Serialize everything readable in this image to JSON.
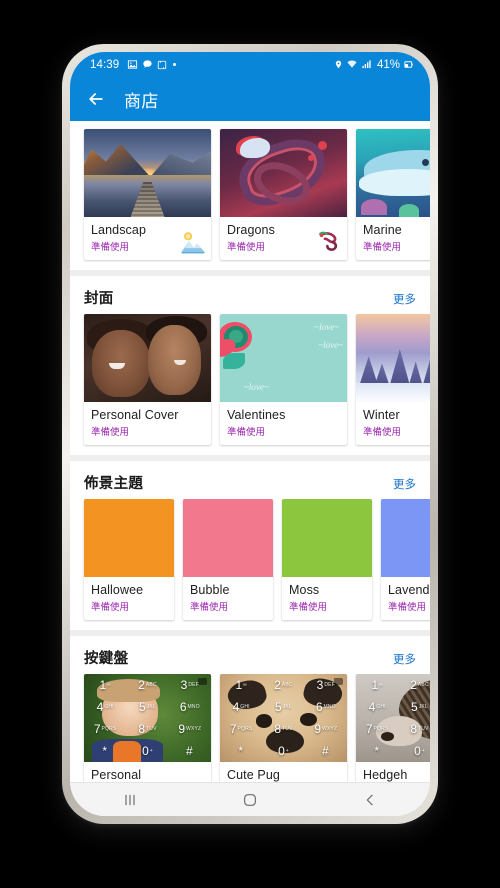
{
  "statusbar": {
    "time": "14:39",
    "battery_pct": "41%",
    "icons_left": [
      "image-icon",
      "chat-icon",
      "screenshot-icon",
      "dot-indicator"
    ],
    "icons_right": [
      "location-icon",
      "wifi-icon",
      "signal-icon",
      "battery-icon"
    ]
  },
  "appbar": {
    "back_icon": "back-arrow-icon",
    "title": "商店",
    "accent_color": "#0a86d8"
  },
  "labels": {
    "more": "更多",
    "ready_to_use": "準備使用"
  },
  "sections": [
    {
      "id": "featured",
      "title": "",
      "more": "",
      "items": [
        {
          "name": "Landscap",
          "status": "準備使用",
          "art": "landscape",
          "badge": "mountain-sun-icon"
        },
        {
          "name": "Dragons",
          "status": "準備使用",
          "art": "dragon",
          "badge": "dragon-icon"
        },
        {
          "name": "Marine",
          "status": "準備使用",
          "art": "marine",
          "badge": ""
        }
      ]
    },
    {
      "id": "covers",
      "title": "封面",
      "more": "更多",
      "items": [
        {
          "name": "Personal Cover",
          "status": "準備使用",
          "art": "personal-cover",
          "badge": ""
        },
        {
          "name": "Valentines",
          "status": "準備使用",
          "art": "valentines",
          "badge": ""
        },
        {
          "name": "Winter",
          "status": "準備使用",
          "art": "winter",
          "badge": ""
        }
      ]
    },
    {
      "id": "themes",
      "title": "佈景主題",
      "more": "更多",
      "items": [
        {
          "name": "Hallowee",
          "status": "準備使用",
          "art": "swatch",
          "color": "#f39422"
        },
        {
          "name": "Bubble",
          "status": "準備使用",
          "art": "swatch",
          "color": "#f2788d"
        },
        {
          "name": "Moss",
          "status": "準備使用",
          "art": "swatch",
          "color": "#8cc63e"
        },
        {
          "name": "Lavend",
          "status": "準備使用",
          "art": "swatch",
          "color": "#7b96f5"
        }
      ]
    },
    {
      "id": "keypad",
      "title": "按鍵盤",
      "more": "更多",
      "items": [
        {
          "name": "Personal",
          "status": "",
          "art": "keypad-baby"
        },
        {
          "name": "Cute Pug",
          "status": "",
          "art": "keypad-pug"
        },
        {
          "name": "Hedgeh",
          "status": "",
          "art": "keypad-hedgehog"
        }
      ]
    }
  ],
  "keypad_keys": [
    {
      "d": "1",
      "s": "∞"
    },
    {
      "d": "2",
      "s": "ABC"
    },
    {
      "d": "3",
      "s": "DEF"
    },
    {
      "d": "4",
      "s": "GHI"
    },
    {
      "d": "5",
      "s": "JKL"
    },
    {
      "d": "6",
      "s": "MNO"
    },
    {
      "d": "7",
      "s": "PQRS"
    },
    {
      "d": "8",
      "s": "TUV"
    },
    {
      "d": "9",
      "s": "WXYZ"
    },
    {
      "d": "*",
      "s": ""
    },
    {
      "d": "0",
      "s": "+"
    },
    {
      "d": "#",
      "s": ""
    }
  ],
  "navbar": {
    "recents": "recents-icon",
    "home": "home-icon",
    "back": "back-icon"
  },
  "valentines_text": [
    "~love~",
    "~love~",
    "~love~"
  ]
}
